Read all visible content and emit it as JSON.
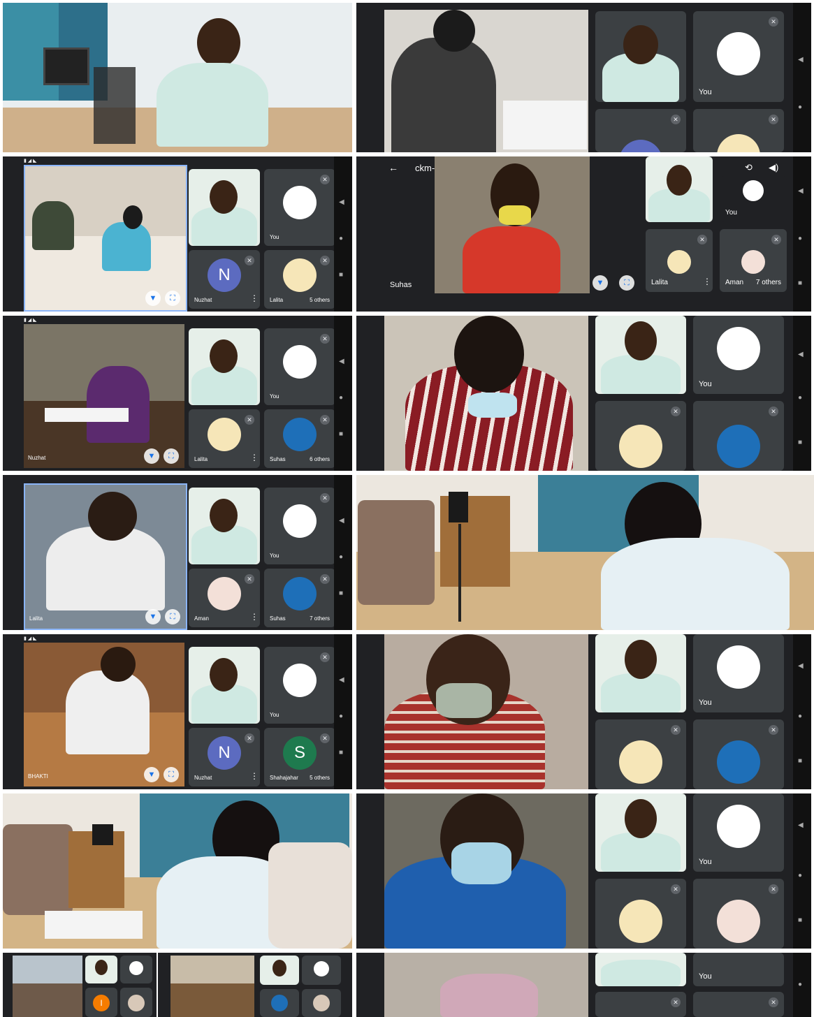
{
  "meeting": {
    "code": "ckm-tphj-did"
  },
  "labels": {
    "you": "You",
    "nuzhat": "Nuzhat",
    "lalita": "Lalita",
    "suhas": "Suhas",
    "aman": "Aman",
    "bhakti": "BHAKTI",
    "shahajahar": "Shahajahar",
    "others5": "5 others",
    "others6": "6 others",
    "others7": "7 others",
    "others7b": "7 others"
  },
  "letters": {
    "n": "N",
    "s": "S",
    "i": "I"
  },
  "icons": [
    "back-arrow-icon",
    "mic-off-icon",
    "more-vert-icon",
    "pin-icon",
    "fullscreen-icon",
    "camera-switch-icon",
    "speaker-icon"
  ],
  "colors": {
    "meet_dark": "#202124",
    "tile": "#3c4043",
    "avatar_n": "#5c6bc0",
    "avatar_s": "#1e7a4e",
    "avatar_i": "#f57c00",
    "accent": "#1a73e8"
  }
}
